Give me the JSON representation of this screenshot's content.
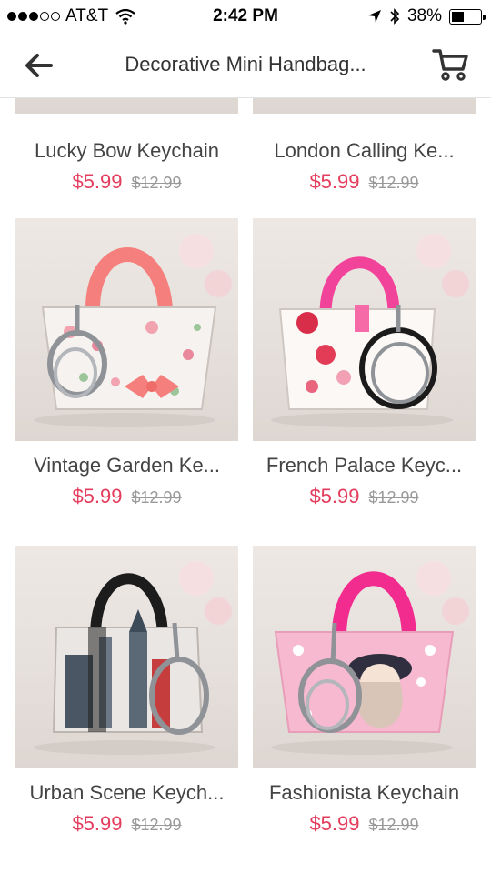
{
  "status_bar": {
    "carrier": "AT&T",
    "time": "2:42 PM",
    "battery": "38%"
  },
  "nav": {
    "title": "Decorative Mini Handbag..."
  },
  "products": [
    {
      "name": "Lucky Bow Keychain",
      "price": "$5.99",
      "original_price": "$12.99"
    },
    {
      "name": "London Calling Ke...",
      "price": "$5.99",
      "original_price": "$12.99"
    },
    {
      "name": "Vintage Garden Ke...",
      "price": "$5.99",
      "original_price": "$12.99"
    },
    {
      "name": "French Palace Keyc...",
      "price": "$5.99",
      "original_price": "$12.99"
    },
    {
      "name": "Urban Scene Keych...",
      "price": "$5.99",
      "original_price": "$12.99"
    },
    {
      "name": "Fashionista Keychain",
      "price": "$5.99",
      "original_price": "$12.99"
    }
  ],
  "colors": {
    "price": "#e43c5c",
    "original_price": "#999999"
  }
}
